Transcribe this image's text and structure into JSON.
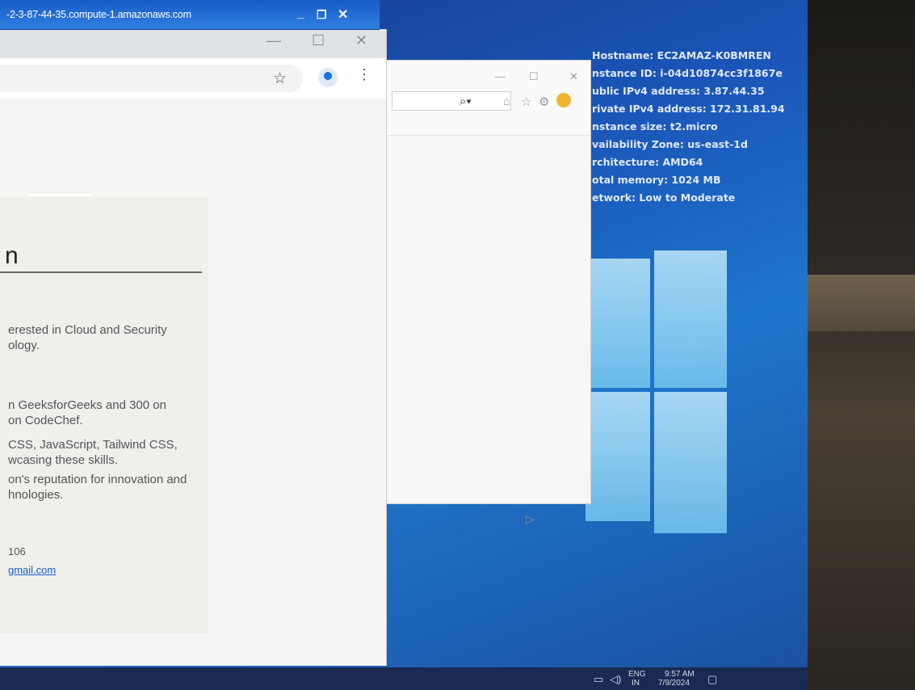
{
  "rdp": {
    "title": "-2-3-87-44-35.compute-1.amazonaws.com",
    "minimize": "_",
    "restore": "❐",
    "close": "✕"
  },
  "bginfo": {
    "lines": [
      "Hostname: EC2AMAZ-K0BMREN",
      "nstance ID: i-04d10874cc3f1867e",
      "ublic IPv4 address: 3.87.44.35",
      "rivate IPv4 address: 172.31.81.94",
      "nstance size: t2.micro",
      "vailability Zone: us-east-1d",
      "rchitecture: AMD64",
      "otal memory: 1024 MB",
      "etwork: Low to Moderate"
    ]
  },
  "ie": {
    "minimize": "—",
    "maximize": "☐",
    "close": "✕",
    "search_icon": "search-icon",
    "toolbar_icons": [
      "home-icon",
      "favorites-star-icon",
      "settings-gear-icon",
      "smiley-feedback-icon"
    ]
  },
  "chrome": {
    "minimize": "—",
    "maximize": "☐",
    "close": "✕",
    "bookmark_icon": "star-icon",
    "menu_icon": "kebab-menu-icon",
    "page": {
      "heading": "n",
      "lines": [
        "erested in Cloud and Security",
        "ology.",
        "n GeeksforGeeks and 300 on",
        "on CodeChef.",
        "CSS, JavaScript, Tailwind CSS,",
        "wcasing these skills.",
        "on's reputation for innovation and",
        "hnologies.",
        "106"
      ],
      "email": "gmail.com"
    }
  },
  "taskbar": {
    "language": "ENG",
    "region": "IN",
    "time": "9:57 AM",
    "date": "7/9/2024"
  }
}
